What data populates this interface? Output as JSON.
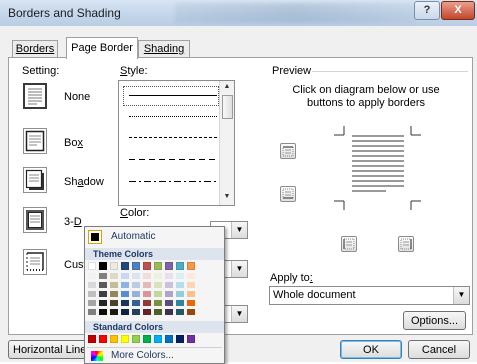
{
  "window": {
    "title": "Borders and Shading",
    "help_label": "?",
    "close_label": "X"
  },
  "tabs": [
    {
      "label": "Borders",
      "active": false
    },
    {
      "label": "Page Border",
      "active": true
    },
    {
      "label": "Shading",
      "active": false
    }
  ],
  "setting": {
    "label": "Setting:",
    "items": [
      {
        "label": "None",
        "selected": true
      },
      {
        "label": "Box",
        "selected": false
      },
      {
        "label": "Shadow",
        "selected": false
      },
      {
        "label": "3-D",
        "selected": false
      },
      {
        "label": "Cust",
        "selected": false
      }
    ]
  },
  "style": {
    "label": "Style:"
  },
  "color": {
    "label": "Color:"
  },
  "preview": {
    "label": "Preview",
    "instructions": "Click on diagram below or use buttons to apply borders"
  },
  "apply_to": {
    "label": "Apply to:",
    "value": "Whole document"
  },
  "buttons": {
    "horizontal_line": "Horizontal Line",
    "options": "Options...",
    "ok": "OK",
    "cancel": "Cancel"
  },
  "color_popup": {
    "automatic_label": "Automatic",
    "theme_colors_label": "Theme Colors",
    "standard_colors_label": "Standard Colors",
    "more_colors_label": "More Colors...",
    "theme_top_row": [
      "#ffffff",
      "#000000",
      "#eeece1",
      "#1f497d",
      "#4f81bd",
      "#c0504d",
      "#9bbb59",
      "#8064a2",
      "#4bacc6",
      "#f79646"
    ],
    "theme_shades": [
      [
        "#f2f2f2",
        "#7f7f7f",
        "#ddd9c3",
        "#c6d9f0",
        "#dbe5f1",
        "#f2dcdb",
        "#ebf1dd",
        "#e5e0ec",
        "#dbeef3",
        "#fdeada"
      ],
      [
        "#d8d8d8",
        "#595959",
        "#c4bd97",
        "#8db3e2",
        "#b8cce4",
        "#e5b9b7",
        "#d7e3bc",
        "#ccc1d9",
        "#b7dde8",
        "#fbd5b5"
      ],
      [
        "#bfbfbf",
        "#3f3f3f",
        "#938953",
        "#548dd4",
        "#95b3d7",
        "#d99694",
        "#c3d69b",
        "#b2a2c7",
        "#92cddc",
        "#fac08f"
      ],
      [
        "#a5a5a5",
        "#262626",
        "#494429",
        "#17365d",
        "#366092",
        "#953734",
        "#76923c",
        "#5f497a",
        "#31859b",
        "#e36c09"
      ],
      [
        "#7f7f7f",
        "#0c0c0c",
        "#1d1b10",
        "#0f243e",
        "#244061",
        "#632423",
        "#4f6128",
        "#3f3151",
        "#205867",
        "#974806"
      ]
    ],
    "standard": [
      "#c00000",
      "#ff0000",
      "#ffc000",
      "#ffff00",
      "#92d050",
      "#00b050",
      "#00b0f0",
      "#0070c0",
      "#002060",
      "#7030a0"
    ]
  }
}
